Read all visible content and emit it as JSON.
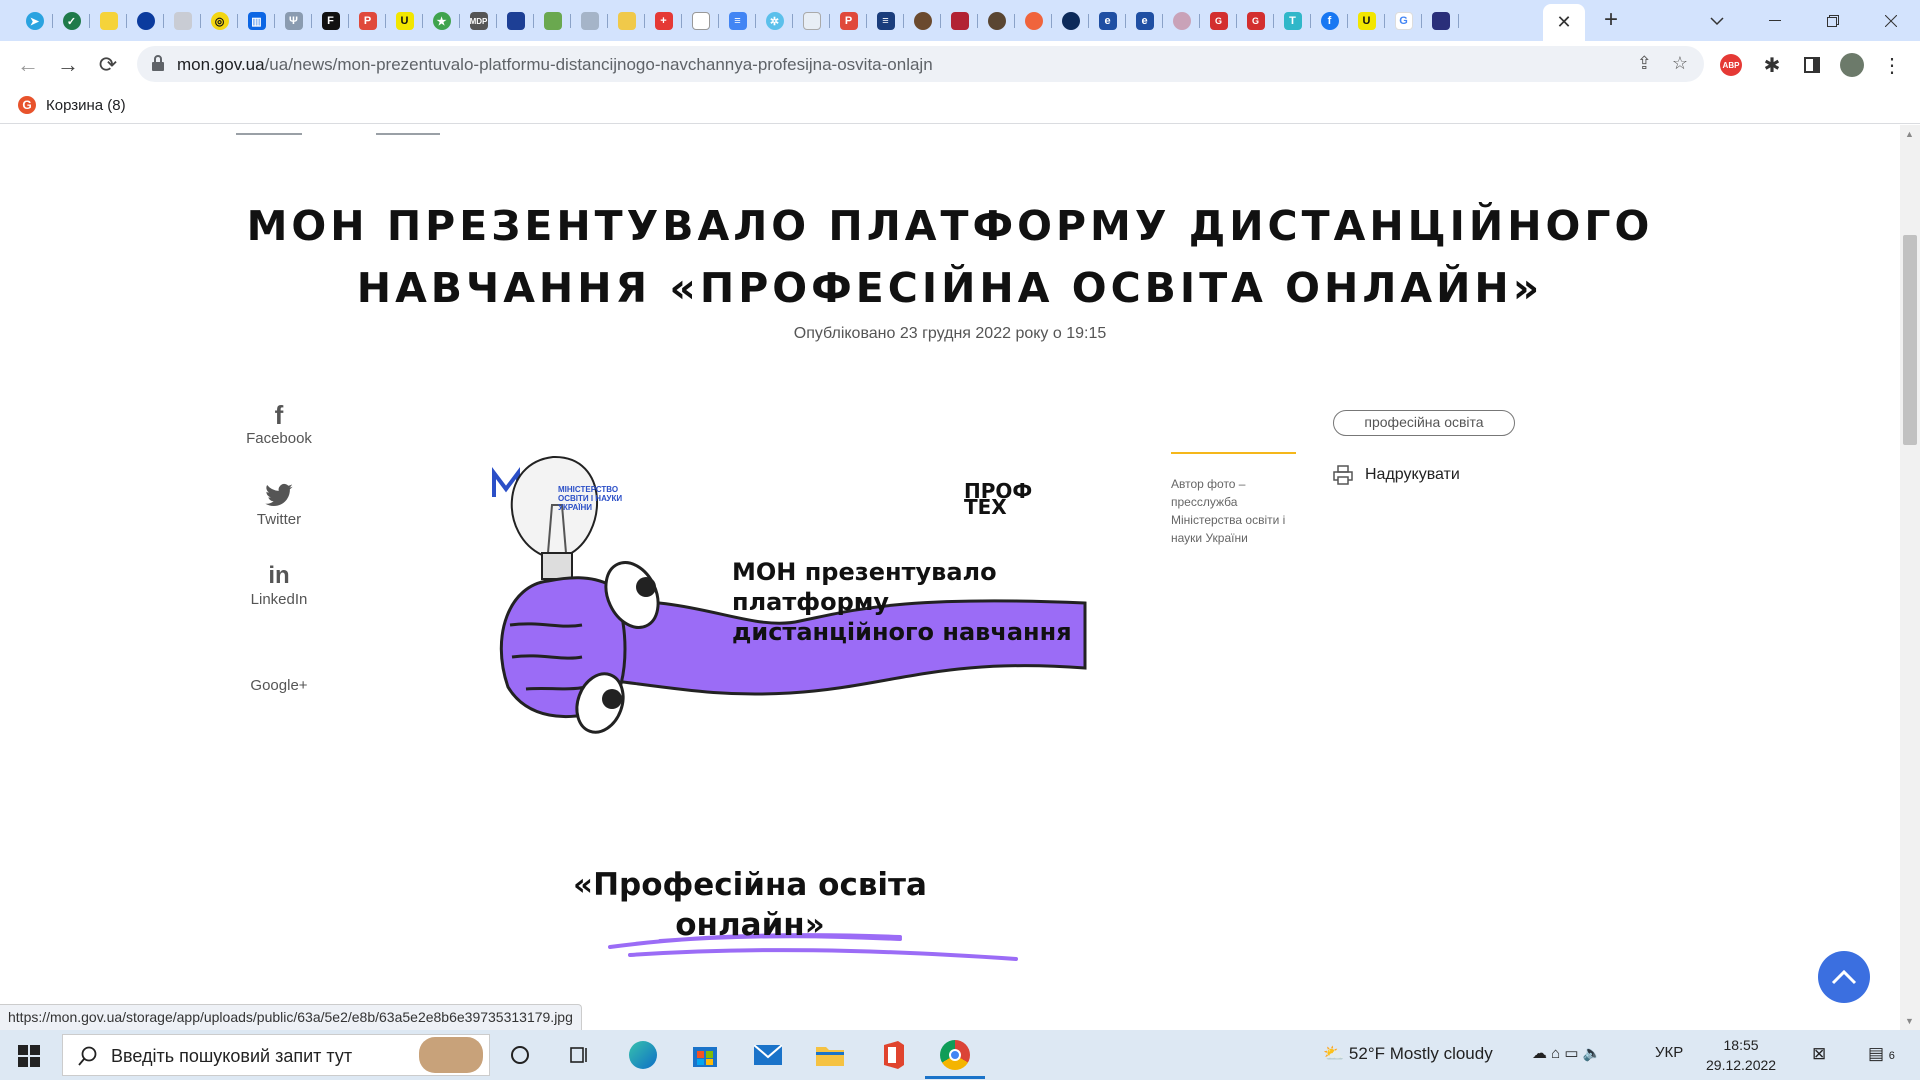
{
  "browser": {
    "active_tab_close": "✕",
    "new_tab": "+",
    "url_host": "mon.gov.ua",
    "url_path": "/ua/news/mon-prezentuvalo-platformu-distancijnogo-navchannya-profesijna-osvita-onlajn",
    "bookmark_label": "Корзина (8)",
    "extension_abp": "ABP"
  },
  "article": {
    "title_line1": "МОН ПРЕЗЕНТУВАЛО ПЛАТФОРМУ ДИСТАНЦІЙНОГО",
    "title_line2": "НАВЧАННЯ «ПРОФЕСІЙНА ОСВІТА ОНЛАЙН»",
    "published": "Опубліковано 23 грудня 2022 року о 19:15",
    "share": {
      "facebook": "Facebook",
      "twitter": "Twitter",
      "linkedin": "LinkedIn",
      "googleplus": "Google+"
    },
    "poster": {
      "mon_logo_text": [
        "МІНІСТЕРСТВО",
        "ОСВІТИ І НАУКИ",
        "УКРАЇНИ"
      ],
      "proftex_line1": "ПРОФ",
      "proftex_line2": "ТЕХ",
      "heading_line1": "МОН презентувало",
      "heading_line2": "платформу",
      "heading_line3": "дистанційного навчання",
      "subtitle_line1": "«Професійна освіта",
      "subtitle_line2": "онлайн»"
    },
    "photo_caption": "Автор фото – пресслужба Міністерства освіти і науки України",
    "tag": "професійна освіта",
    "print_label": "Надрукувати"
  },
  "status_url": "https://mon.gov.ua/storage/app/uploads/public/63a/5e2/e8b/63a5e2e8b6e39735313179.jpg",
  "taskbar": {
    "search_placeholder": "Введіть пошуковий запит тут",
    "weather_temp": "52°F",
    "weather_text": "Mostly cloudy",
    "language": "УКР",
    "time": "18:55",
    "date": "29.12.2022",
    "notifications": "6"
  },
  "colors": {
    "accent_purple": "#9b6cf6",
    "caption_rule": "#f5b71a",
    "up_button": "#3b6fe0",
    "mon_blue": "#2b4fc7"
  }
}
